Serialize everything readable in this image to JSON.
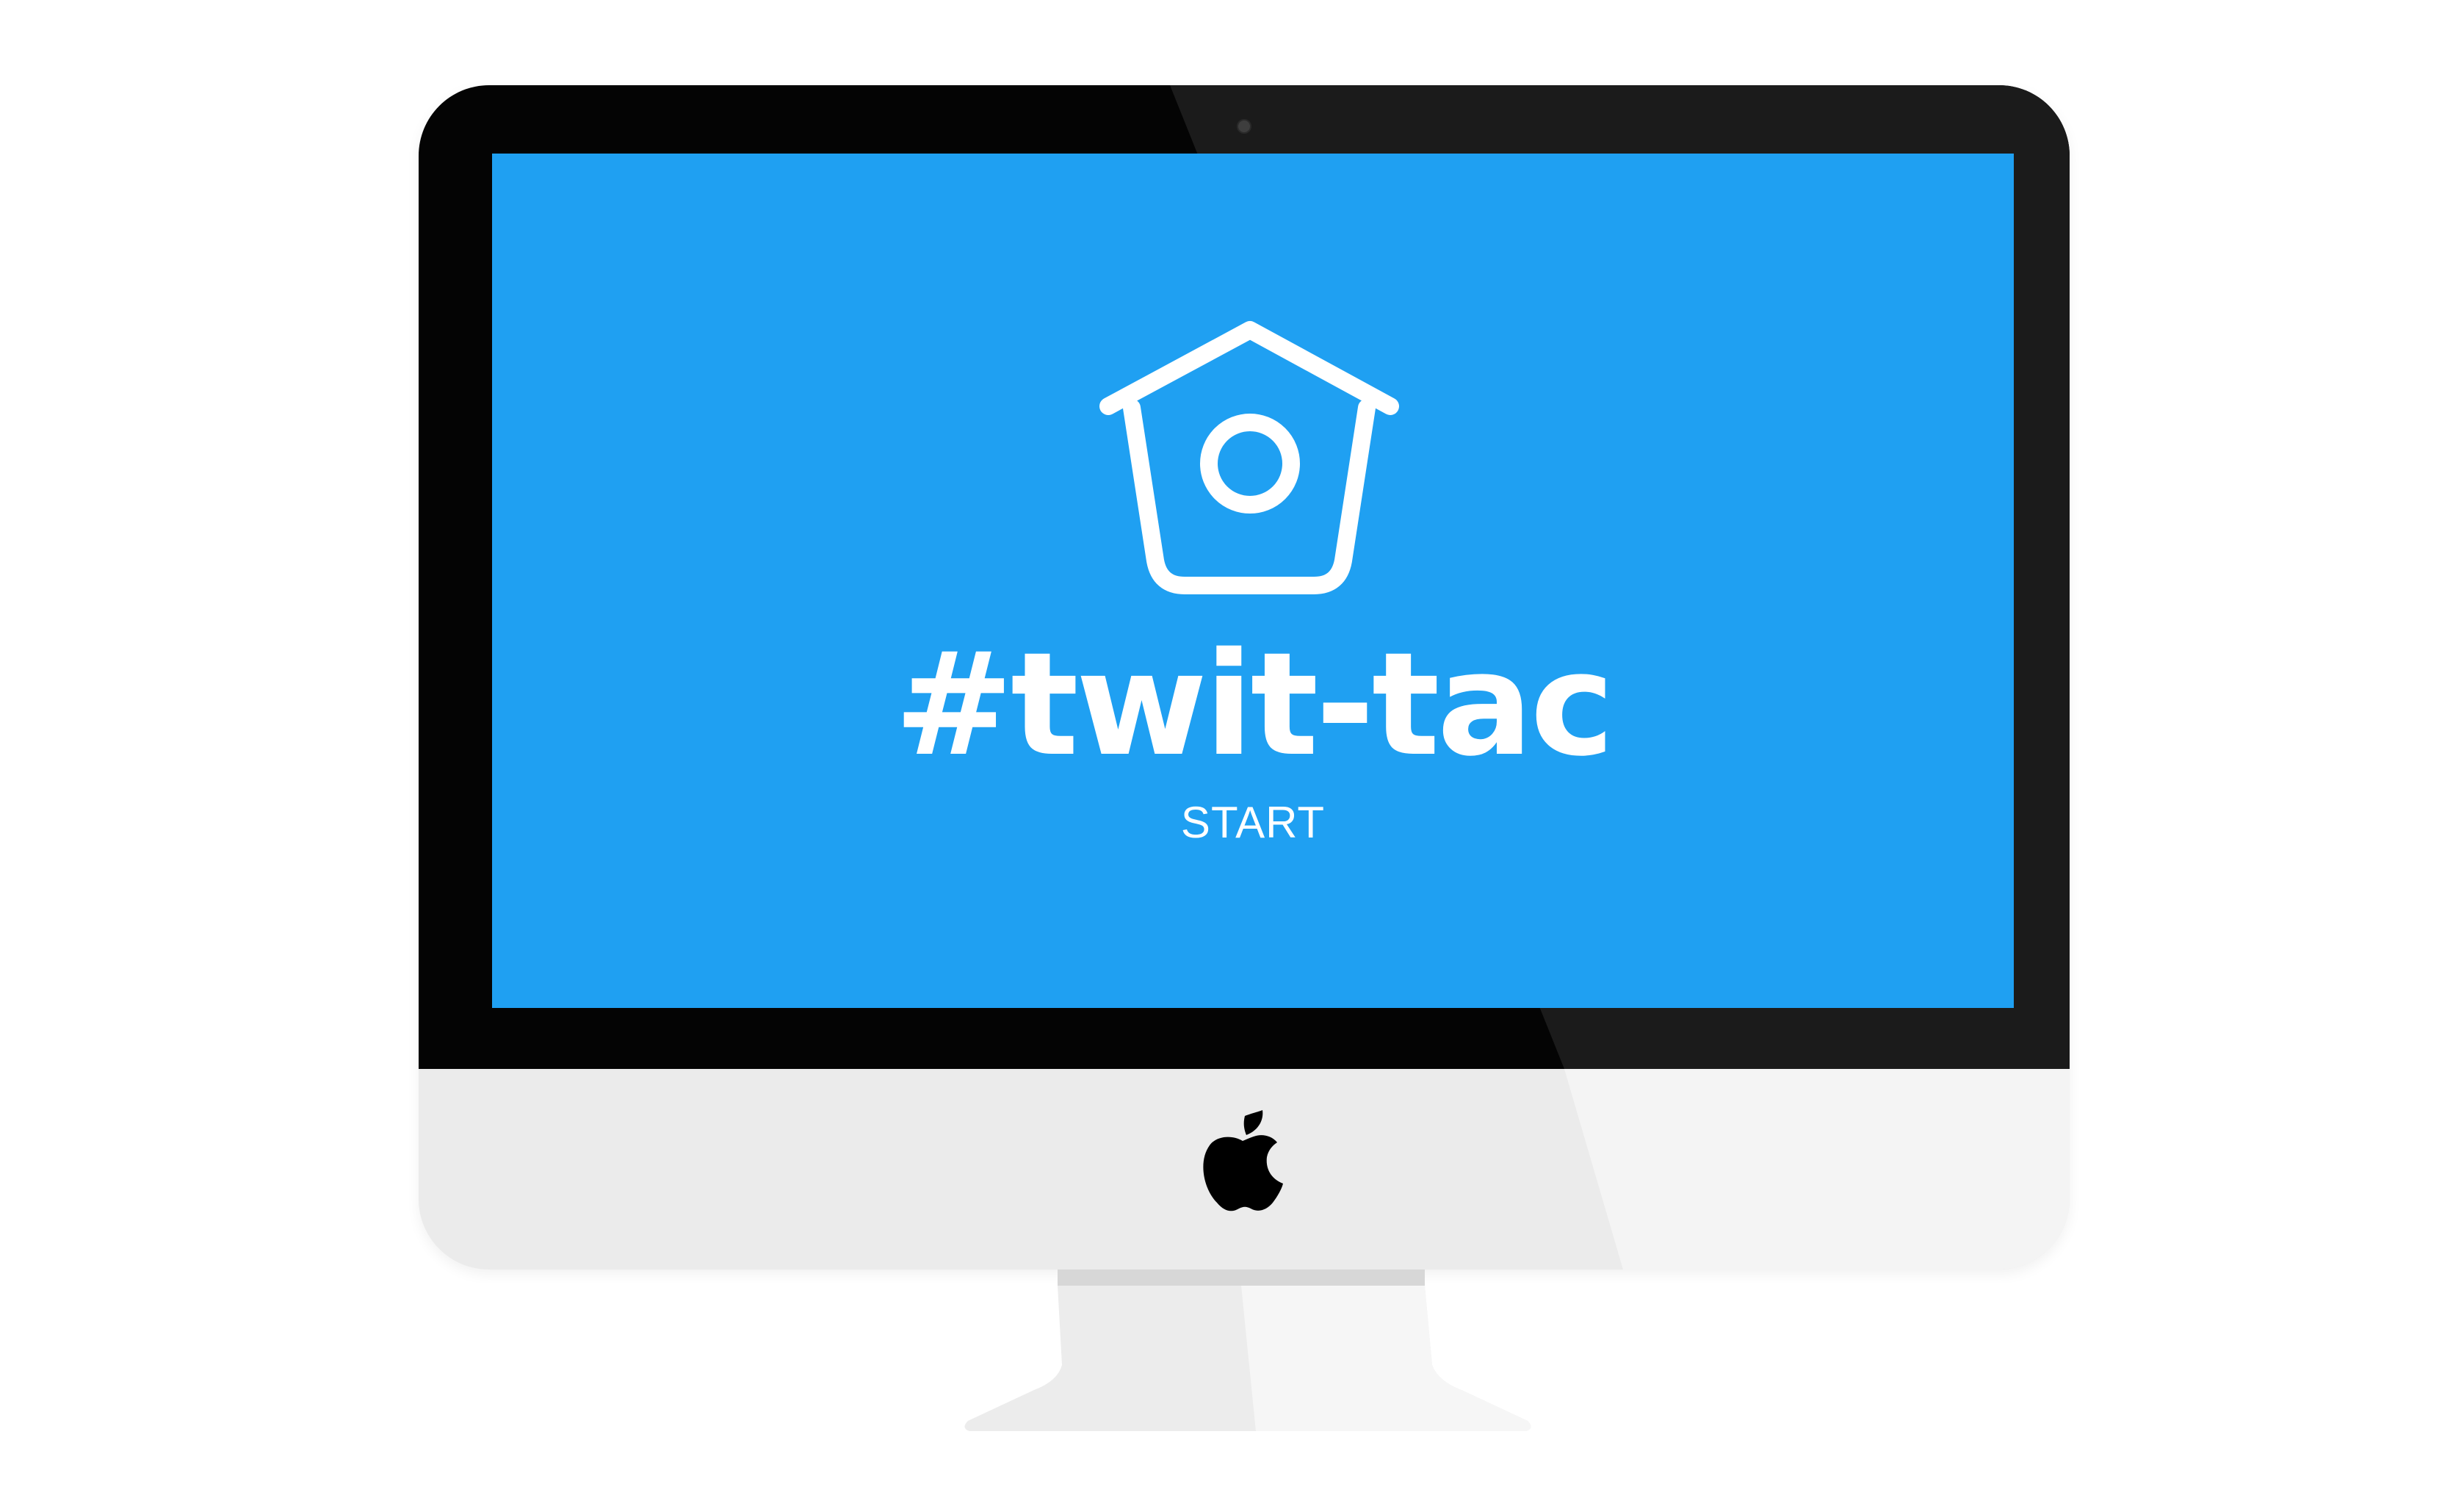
{
  "app": {
    "title": "#twit-tac",
    "start_label": "START"
  },
  "icons": {
    "logo": "birdhouse-icon",
    "brand": "apple-logo-icon"
  },
  "colors": {
    "screen_background": "#1fa0f2",
    "foreground": "#ffffff",
    "bezel": "#040404",
    "chin": "#ebebeb"
  }
}
